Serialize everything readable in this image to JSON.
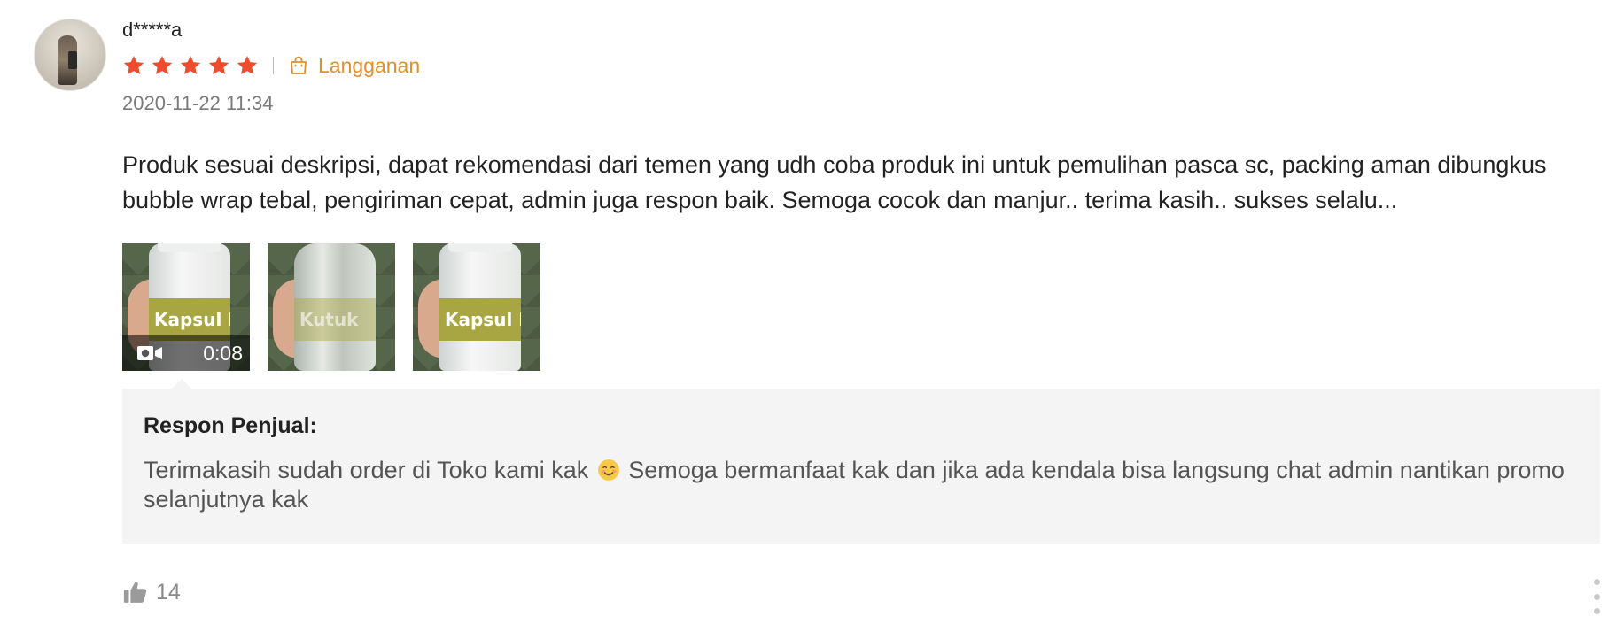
{
  "review": {
    "username": "d*****a",
    "rating": 5,
    "variant_label": "Langganan",
    "timestamp": "2020-11-22 11:34",
    "content": "Produk sesuai deskripsi, dapat rekomendasi dari temen yang udh coba produk ini untuk pemulihan pasca sc, packing aman dibungkus bubble wrap tebal, pengiriman cepat, admin juga respon baik. Semoga cocok dan manjur.. terima kasih.. sukses selalu...",
    "media": [
      {
        "type": "video",
        "duration": "0:08",
        "label": "Kapsul Kutuk"
      },
      {
        "type": "image",
        "label": "Kutuk"
      },
      {
        "type": "image",
        "label": "Kapsul Kutuk"
      }
    ],
    "seller_reply": {
      "title": "Respon Penjual:",
      "text_before_emoji": "Terimakasih sudah order di Toko kami kak ",
      "text_after_emoji": " Semoga bermanfaat kak dan jika ada kendala bisa langsung chat admin nantikan promo selanjutnya kak"
    },
    "likes": "14"
  },
  "colors": {
    "star": "#ee4d2d",
    "variant": "#e0902d",
    "reply_bg": "#f4f4f4",
    "muted": "#7a7a7a"
  },
  "icons": {
    "star": "star-icon",
    "variant": "shopping-bag-icon",
    "video": "video-camera-icon",
    "like": "thumbs-up-icon",
    "more": "more-vertical-icon",
    "emoji": "smiling-face-emoji"
  }
}
